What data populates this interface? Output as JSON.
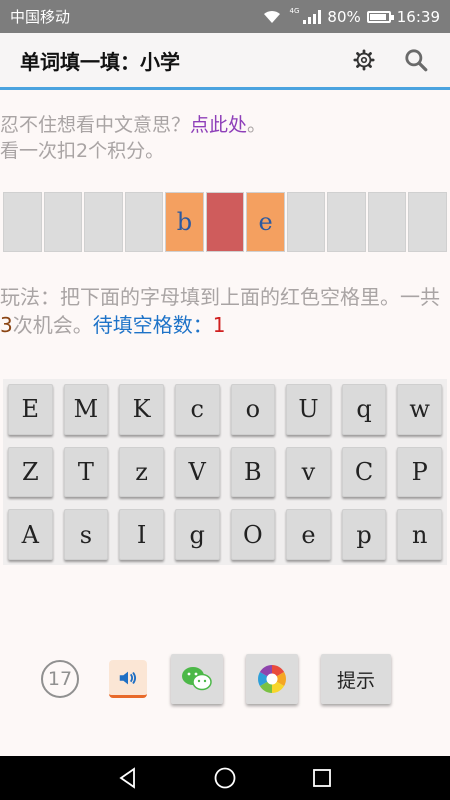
{
  "status": {
    "carrier": "中国移动",
    "network_tag": "4G",
    "battery": "80%",
    "time": "16:39",
    "battery_level": 0.8
  },
  "appbar": {
    "title": "单词填一填：小学",
    "settings_icon": "gear-icon",
    "search_icon": "search-icon"
  },
  "hint": {
    "line1_prefix": "忍不住想看中文意思？",
    "line1_link": "点此处",
    "line1_suffix": "。",
    "line2": "看一次扣2个积分。"
  },
  "slots": [
    {
      "letter": "",
      "state": "empty"
    },
    {
      "letter": "",
      "state": "empty"
    },
    {
      "letter": "",
      "state": "empty"
    },
    {
      "letter": "",
      "state": "empty"
    },
    {
      "letter": "b",
      "state": "filled"
    },
    {
      "letter": "",
      "state": "blank"
    },
    {
      "letter": "e",
      "state": "filled"
    },
    {
      "letter": "",
      "state": "empty"
    },
    {
      "letter": "",
      "state": "empty"
    },
    {
      "letter": "",
      "state": "empty"
    },
    {
      "letter": "",
      "state": "empty"
    }
  ],
  "rules": {
    "text1": "玩法：把下面的字母填到上面的红色空格里。一共",
    "chances": "3",
    "text2": "次机会。",
    "remaining_label": "待填空格数：",
    "remaining_count": "1"
  },
  "keys": [
    "E",
    "M",
    "K",
    "c",
    "o",
    "U",
    "q",
    "w",
    "Z",
    "T",
    "z",
    "V",
    "B",
    "v",
    "C",
    "P",
    "A",
    "s",
    "I",
    "g",
    "O",
    "e",
    "p",
    "n"
  ],
  "toolbar": {
    "counter": "17",
    "sound_icon": "speaker-icon",
    "wechat_icon": "wechat-icon",
    "share_icon": "camera-aperture-icon",
    "hint_label": "提示"
  },
  "colors": {
    "accent": "#4aa3df",
    "filled_slot": "#f4a060",
    "blank_slot": "#cf5c5c",
    "link": "#8e3fb9",
    "remaining": "#1e73c8"
  }
}
